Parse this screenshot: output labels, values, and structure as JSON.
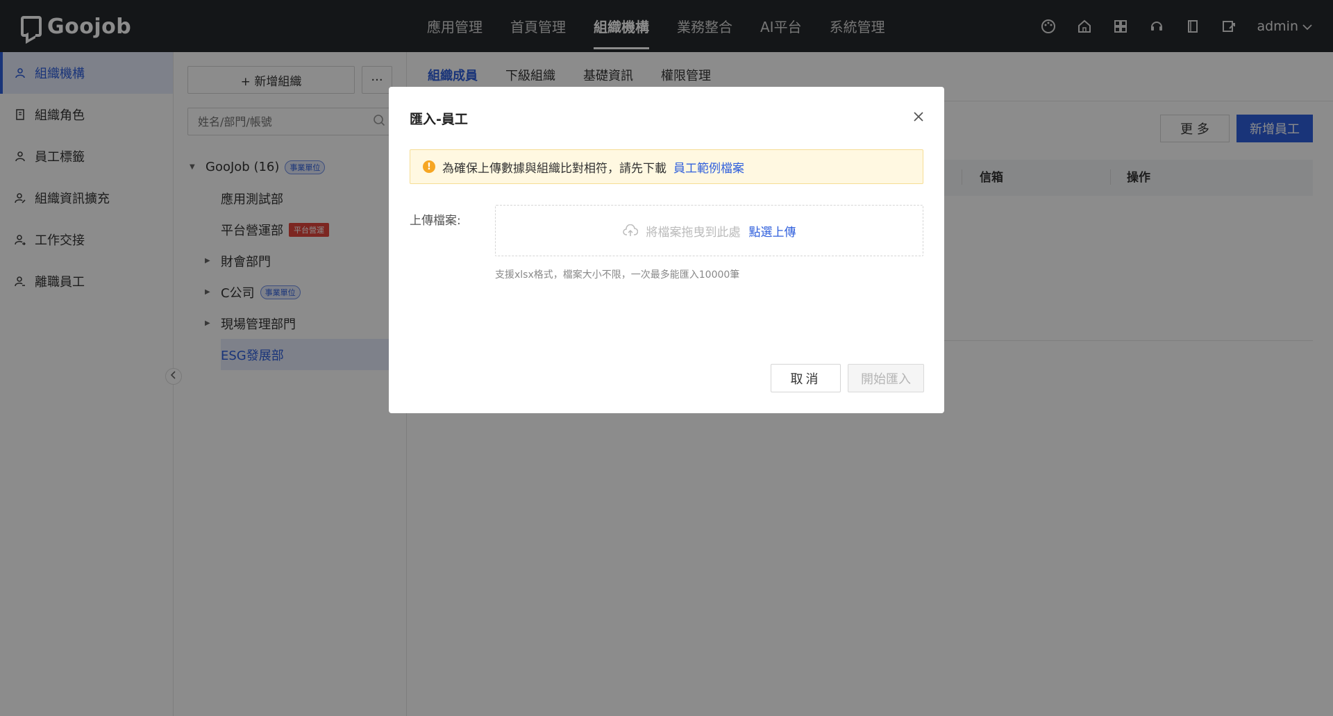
{
  "brand": {
    "name": "Goojob"
  },
  "topnav": {
    "items": [
      {
        "label": "應用管理"
      },
      {
        "label": "首頁管理"
      },
      {
        "label": "組織機構"
      },
      {
        "label": "業務整合"
      },
      {
        "label": "AI平台"
      },
      {
        "label": "系統管理"
      }
    ],
    "active_index": 2,
    "user": "admin"
  },
  "sidebar": {
    "items": [
      {
        "label": "組織機構",
        "icon": "org-icon"
      },
      {
        "label": "組織角色",
        "icon": "role-icon"
      },
      {
        "label": "員工標籤",
        "icon": "tag-user-icon"
      },
      {
        "label": "組織資訊擴充",
        "icon": "user-edit-icon"
      },
      {
        "label": "工作交接",
        "icon": "handover-icon"
      },
      {
        "label": "離職員工",
        "icon": "resigned-user-icon"
      }
    ],
    "active_index": 0
  },
  "tree_panel": {
    "add_button": "+ 新增組織",
    "more_button": "···",
    "search_placeholder": "姓名/部門/帳號",
    "root": {
      "label": "GooJob (16)",
      "tag": "事業單位"
    },
    "nodes": [
      {
        "label": "應用測試部"
      },
      {
        "label": "平台營運部",
        "tag": "平台營運"
      },
      {
        "label": "財會部門"
      },
      {
        "label": "C公司",
        "tag": "事業單位"
      },
      {
        "label": "現場管理部門"
      },
      {
        "label": "ESG發展部"
      }
    ]
  },
  "main": {
    "tabs": [
      {
        "label": "組織成員"
      },
      {
        "label": "下級組織"
      },
      {
        "label": "基礎資訊"
      },
      {
        "label": "權限管理"
      }
    ],
    "more_button": "更 多",
    "add_button": "新增員工",
    "columns": {
      "email": "信箱",
      "actions": "操作"
    }
  },
  "modal": {
    "title": "匯入-員工",
    "notice_text": "為確保上傳數據與組織比對相符，請先下載",
    "notice_link": "員工範例檔案",
    "upload_label": "上傳檔案:",
    "dropzone_text": "將檔案拖曳到此處",
    "dropzone_link": "點選上傳",
    "hint": "支援xlsx格式，檔案大小不限，一次最多能匯入10000筆",
    "cancel_button": "取消",
    "start_button": "開始匯入"
  },
  "colors": {
    "primary": "#2f5fdc",
    "topbar": "#26282c",
    "warning": "#f6a623",
    "tag_red": "#e2453c"
  }
}
